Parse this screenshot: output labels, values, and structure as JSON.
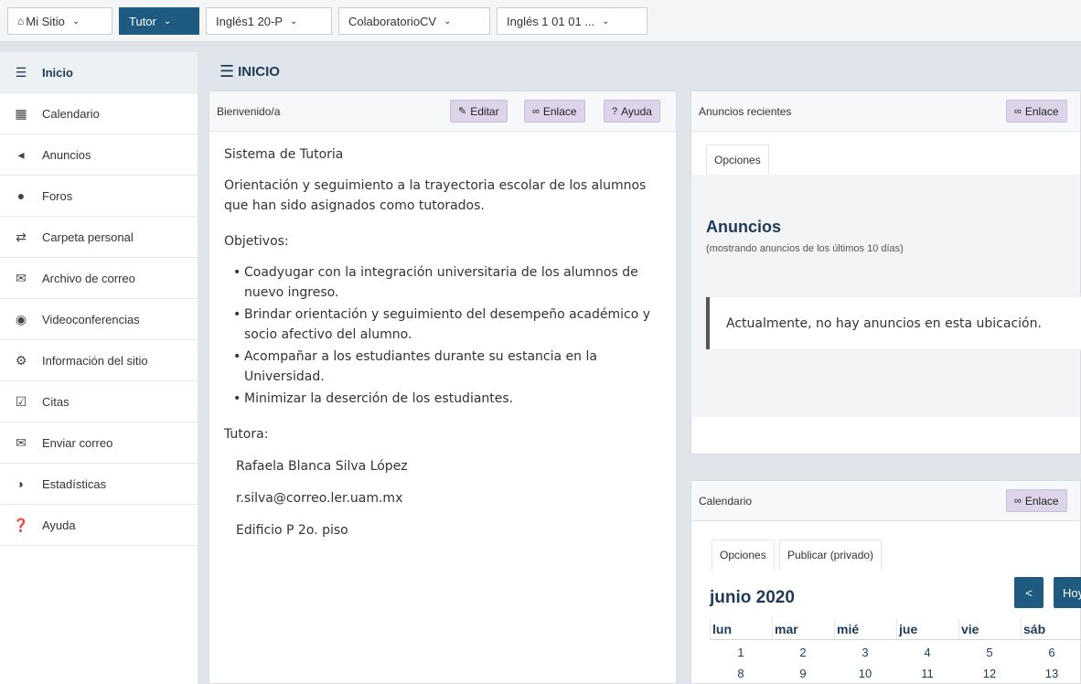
{
  "topnav": {
    "tabs": [
      {
        "label": "Mi Sitio",
        "icon": "home-icon"
      },
      {
        "label": "Tutor"
      },
      {
        "label": "Inglés1 20-P"
      },
      {
        "label": "ColaboratorioCV"
      },
      {
        "label": "Inglés 1 01 01 ..."
      }
    ]
  },
  "sidebar": {
    "items": [
      {
        "label": "Inicio",
        "icon": "list-icon"
      },
      {
        "label": "Calendario",
        "icon": "calendar-icon"
      },
      {
        "label": "Anuncios",
        "icon": "megaphone-icon"
      },
      {
        "label": "Foros",
        "icon": "comments-icon"
      },
      {
        "label": "Carpeta personal",
        "icon": "exchange-icon"
      },
      {
        "label": "Archivo de correo",
        "icon": "envelope-icon"
      },
      {
        "label": "Videoconferencias",
        "icon": "globe-icon"
      },
      {
        "label": "Información del sitio",
        "icon": "gear-icon"
      },
      {
        "label": "Citas",
        "icon": "calendar-check-icon"
      },
      {
        "label": "Enviar correo",
        "icon": "envelope-icon"
      },
      {
        "label": "Estadísticas",
        "icon": "pie-chart-icon"
      },
      {
        "label": "Ayuda",
        "icon": "question-icon"
      }
    ]
  },
  "page": {
    "title": "INICIO"
  },
  "welcome": {
    "header": "Bienvenido/a",
    "edit_label": "Editar",
    "link_label": "Enlace",
    "help_label": "Ayuda",
    "heading": "Sistema de Tutoria",
    "intro_line1": "Orientación y seguimiento a la trayectoria escolar de los alumnos",
    "intro_line2": "que han sido asignados como tutorados.",
    "objectives_label": "Objetivos:",
    "objectives": [
      {
        "line1": "Coadyugar con la integración universitaria de los alumnos de",
        "line2": "nuevo ingreso."
      },
      {
        "line1": "Brindar orientación y seguimiento del desempeño académico y",
        "line2": "socio afectivo del alumno."
      },
      {
        "line1": "Acompañar a los estudiantes durante su estancia en la",
        "line2": "Universidad."
      },
      {
        "line1": "Minimizar la deserción de los estudiantes.",
        "line2": ""
      }
    ],
    "tutor_label": "Tutora:",
    "tutor_name": "Rafaela Blanca Silva López",
    "tutor_email": "r.silva@correo.ler.uam.mx",
    "tutor_office": "Edificio P 2o. piso"
  },
  "announcements": {
    "header": "Anuncios recientes",
    "link_label": "Enlace",
    "options_label": "Opciones",
    "title": "Anuncios",
    "subtitle": "(mostrando anuncios de los últimos 10 días)",
    "empty_message": "Actualmente, no hay anuncios en esta ubicación."
  },
  "calendar": {
    "header": "Calendario",
    "link_label": "Enlace",
    "options_label": "Opciones",
    "publish_label": "Publicar (privado)",
    "month": "junio 2020",
    "prev_label": "<",
    "today_label": "Hoy",
    "weekdays": [
      "lun",
      "mar",
      "mié",
      "jue",
      "vie",
      "sáb"
    ],
    "week1": [
      "1",
      "2",
      "3",
      "4",
      "5",
      "6"
    ],
    "week2": [
      "8",
      "9",
      "10",
      "11",
      "12",
      "13"
    ]
  },
  "colors": {
    "accent": "#1f5a80",
    "title": "#1f3a58",
    "button": "#ddd4e9",
    "background": "#dfe5ea"
  }
}
